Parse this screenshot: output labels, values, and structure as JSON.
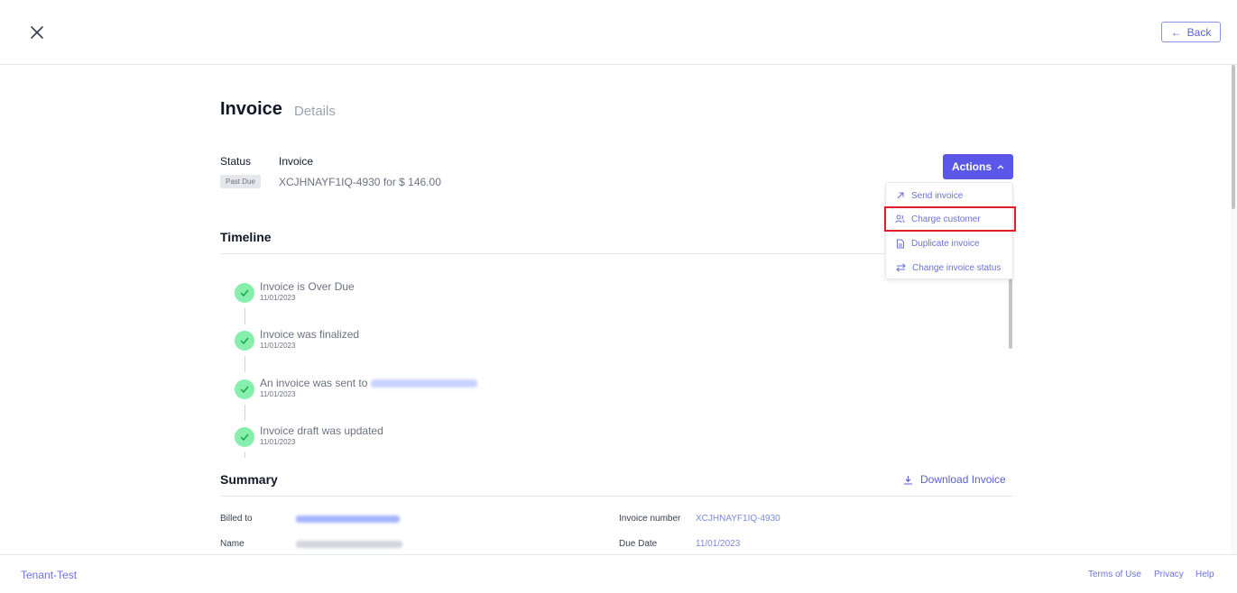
{
  "header": {
    "back_label": "Back"
  },
  "page": {
    "title": "Invoice",
    "subtitle": "Details"
  },
  "status": {
    "status_label": "Status",
    "invoice_label": "Invoice",
    "badge": "Past Due",
    "invoice_summary": "XCJHNAYF1IQ-4930 for $ 146.00"
  },
  "actions": {
    "button_label": "Actions",
    "menu": [
      {
        "label": "Send invoice",
        "icon": "arrow-up-right-icon"
      },
      {
        "label": "Charge customer",
        "icon": "users-icon"
      },
      {
        "label": "Duplicate invoice",
        "icon": "document-icon"
      },
      {
        "label": "Change invoice status",
        "icon": "swap-icon"
      }
    ]
  },
  "timeline": {
    "title": "Timeline",
    "events": [
      {
        "title": "Invoice is Over Due",
        "date": "11/01/2023"
      },
      {
        "title": "Invoice was finalized",
        "date": "11/01/2023"
      },
      {
        "title": "An invoice was sent to",
        "date": "11/01/2023"
      },
      {
        "title": "Invoice draft was updated",
        "date": "11/01/2023"
      }
    ]
  },
  "summary": {
    "title": "Summary",
    "download_label": "Download Invoice",
    "billed_to_label": "Billed to",
    "name_label": "Name",
    "invoice_number_label": "Invoice number",
    "invoice_number_value": "XCJHNAYF1IQ-4930",
    "due_date_label": "Due Date",
    "due_date_value": "11/01/2023"
  },
  "footer": {
    "tenant": "Tenant-Test",
    "terms": "Terms of Use",
    "privacy": "Privacy",
    "help": "Help"
  },
  "colors": {
    "accent": "#5b57e8",
    "link": "#6b72d6",
    "success": "#86efac",
    "highlight_border": "#e11d2a"
  }
}
